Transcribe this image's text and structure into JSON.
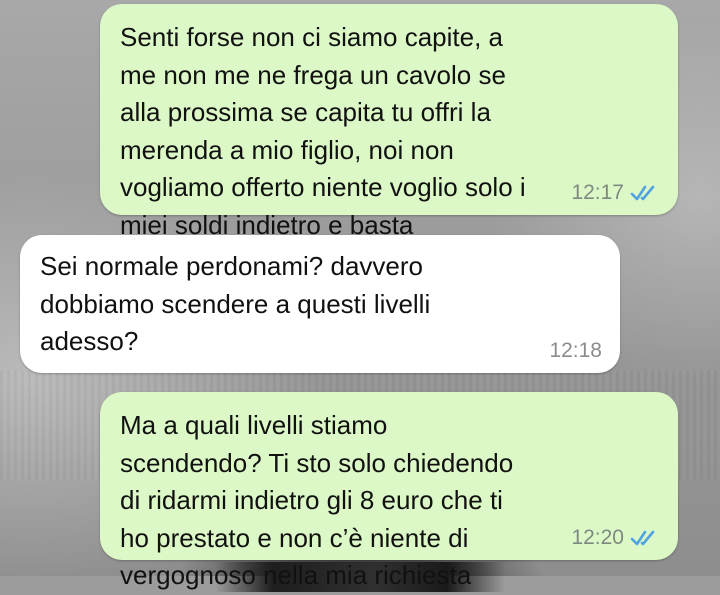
{
  "chat": {
    "messages": [
      {
        "direction": "outgoing",
        "text": "Senti forse non ci siamo capite, a me non me ne frega un cavolo se alla prossima se capita tu offri la merenda a mio figlio, noi non vogliamo offerto niente voglio solo i miei soldi indietro e basta",
        "time": "12:17",
        "status_icon": "double-check-read-icon"
      },
      {
        "direction": "incoming",
        "text": "Sei normale perdonami? davvero dobbiamo scendere a questi livelli adesso?",
        "time": "12:18"
      },
      {
        "direction": "outgoing",
        "text": "Ma a quali livelli stiamo scendendo? Ti sto solo chiedendo di ridarmi indietro gli 8 euro che ti ho prestato e non c’è niente di vergognoso nella mia richiesta",
        "time": "12:20",
        "status_icon": "double-check-read-icon"
      }
    ]
  },
  "colors": {
    "outgoing_bubble": "#dcf8c6",
    "incoming_bubble": "#ffffff",
    "read_ticks": "#4fa3e0"
  }
}
